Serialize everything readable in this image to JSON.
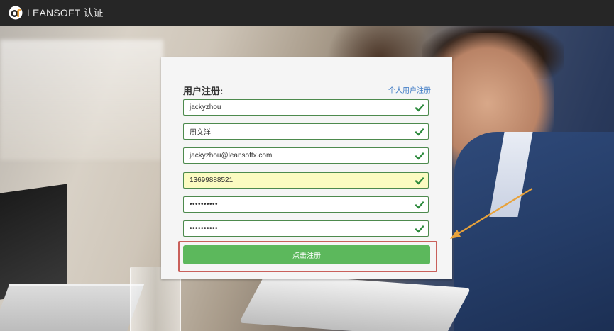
{
  "header": {
    "brand_name": "LEANSOFT 认证",
    "logo_icon": "leansoft-logo-icon"
  },
  "form": {
    "title": "用户注册:",
    "switch_link": "个人用户注册",
    "fields": [
      {
        "value": "jackyzhou",
        "valid": true
      },
      {
        "value": "周文洋",
        "valid": true
      },
      {
        "value": "jackyzhou@leansoftx.com",
        "valid": true
      },
      {
        "value": "13699888521",
        "valid": true,
        "autofilled": true
      },
      {
        "value": "••••••••••",
        "valid": true,
        "masked": true
      },
      {
        "value": "••••••••••",
        "valid": true,
        "masked": true
      }
    ],
    "submit_label": "点击注册"
  },
  "colors": {
    "topbar": "#262626",
    "valid_border": "#4d8a4d",
    "check": "#2e8b3e",
    "submit": "#5cb85c",
    "link": "#3b78c4",
    "highlight_frame": "#c9605b",
    "arrow": "#e8a23a"
  }
}
